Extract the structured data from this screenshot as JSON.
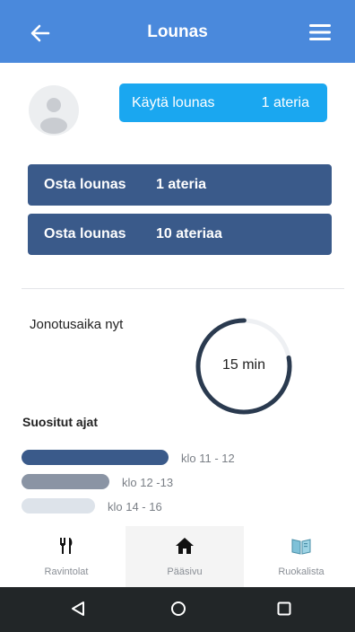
{
  "header": {
    "title": "Lounas",
    "back_icon": "arrow-left-icon",
    "menu_icon": "hamburger-menu-icon",
    "color": "#4a89dc"
  },
  "profile": {
    "avatar_icon": "user-avatar-icon"
  },
  "use_lunch": {
    "label": "Käytä lounas",
    "count": "1 ateria",
    "color": "#1aa7f0"
  },
  "buy_options": [
    {
      "label": "Osta lounas",
      "count": "1 ateria"
    },
    {
      "label": "Osta lounas",
      "count": "10 ateriaa"
    }
  ],
  "buy_color": "#3a5a8a",
  "queue": {
    "label": "Jonotusaika nyt",
    "value": "15 min",
    "progress": 0.78
  },
  "popular": {
    "title": "Suositut ajat",
    "slots": [
      {
        "label": "klo 11 - 12",
        "level": 1.0,
        "color": "#3a5a8a"
      },
      {
        "label": "klo 12 -13",
        "level": 0.6,
        "color": "#8a94a4"
      },
      {
        "label": "klo 14 - 16",
        "level": 0.5,
        "color": "#dde3ea"
      }
    ]
  },
  "bottom_nav": [
    {
      "label": "Ravintolat",
      "icon": "fork-knife-icon"
    },
    {
      "label": "Pääsivu",
      "icon": "home-icon",
      "active": true
    },
    {
      "label": "Ruokalista",
      "icon": "menu-book-icon"
    }
  ],
  "system_nav": [
    "back-triangle-icon",
    "home-circle-icon",
    "recents-square-icon"
  ]
}
